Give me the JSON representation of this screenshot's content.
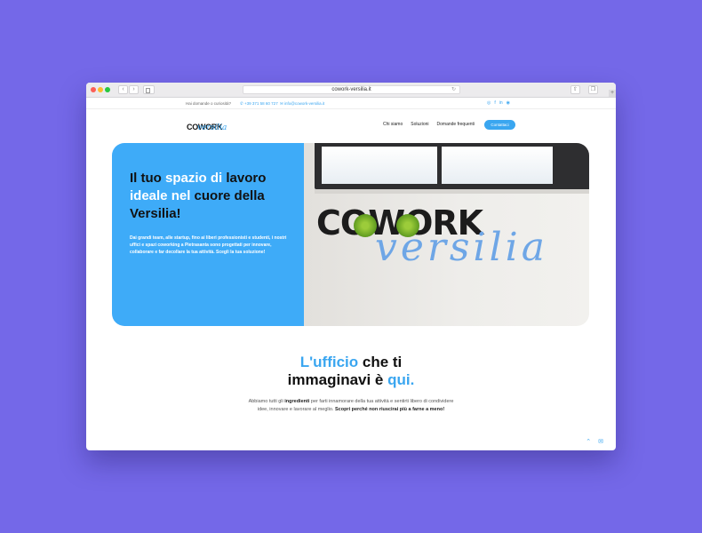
{
  "browser": {
    "url": "cowork-versilia.it"
  },
  "topbar": {
    "question": "Hai domande o curiosità?",
    "phone": "+39 371 58 60 727",
    "email": "info@cowork-versilia.it",
    "social_icons": [
      "whatsapp-icon",
      "facebook-icon",
      "linkedin-icon",
      "instagram-icon"
    ]
  },
  "header": {
    "logo_main": "COWORK",
    "logo_script": "versilia",
    "menu": [
      "Chi siamo",
      "Soluzioni",
      "Domande frequenti"
    ],
    "cta": "Contattaci"
  },
  "hero": {
    "title_parts": [
      "Il tuo ",
      "spazio di",
      " lavoro ",
      "ideale nel",
      " cuore della Versilia!"
    ],
    "description": "Dai grandi team, alle startup, fino ai liberi professionisti e studenti, i nostri uffici e spazi coworking a Pietrasanta sono progettati per innovare, collaborare e far decollare la tua attività. Scegli la tua soluzione!",
    "image_word_main": "COWORK",
    "image_word_script": "versilia"
  },
  "section2": {
    "title_l1a": "L'ufficio",
    "title_l1b": " che ti",
    "title_l2a": "immaginavi è ",
    "title_l2b": "qui.",
    "text_a": "Abbiamo tutti gli ",
    "text_b": "ingredienti",
    "text_c": " per farti innamorare della tua attività e sentirti libero di condividere idee, innovare e lavorare al meglio. ",
    "text_d": "Scopri perché non riuscirai più a farne a meno!"
  },
  "colors": {
    "accent": "#3aa6f0",
    "background": "#7468e8"
  }
}
